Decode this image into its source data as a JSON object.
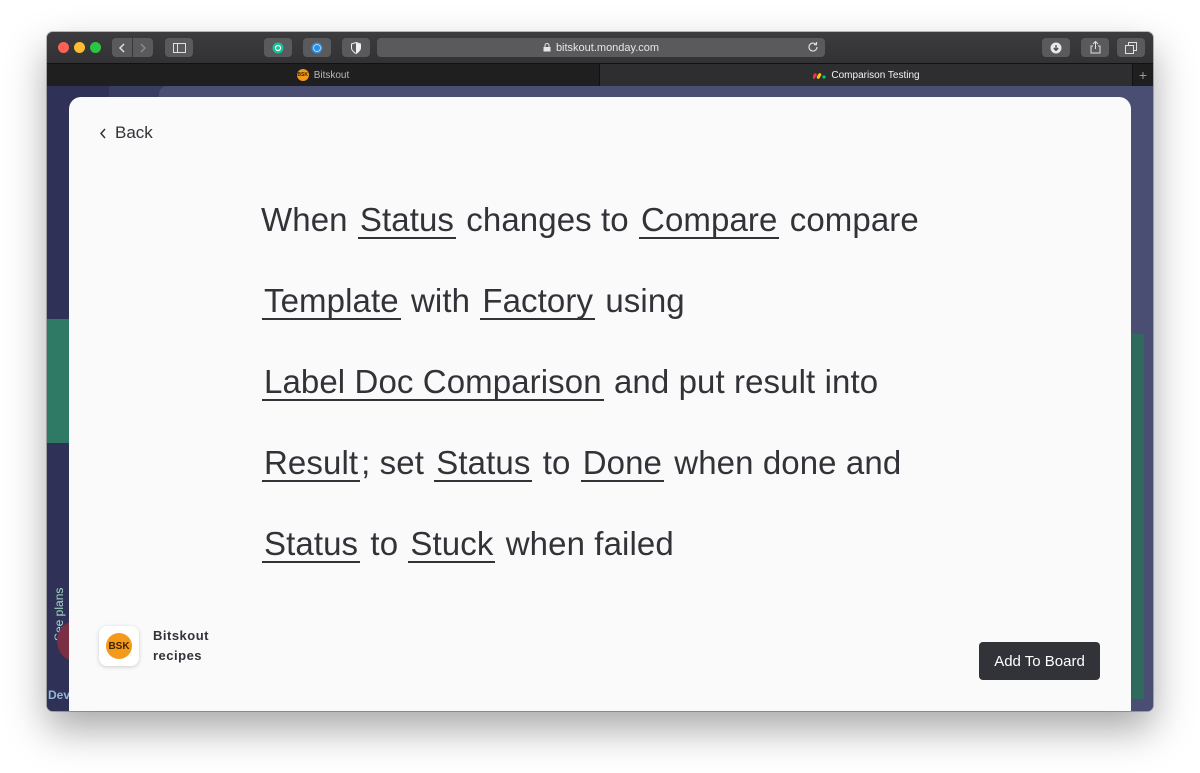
{
  "browser": {
    "url": "bitskout.monday.com",
    "tabs": [
      {
        "label": "Bitskout",
        "icon_text": "BSK",
        "active": false
      },
      {
        "label": "Comparison Testing",
        "active": true
      }
    ]
  },
  "background": {
    "see_plans_label": "See plans",
    "dev_label": "Dev"
  },
  "modal": {
    "back_label": "Back",
    "sentence": {
      "lines": [
        [
          {
            "text": "When ",
            "slot": false
          },
          {
            "text": "Status",
            "slot": true
          },
          {
            "text": " changes to ",
            "slot": false
          },
          {
            "text": "Compare",
            "slot": true
          },
          {
            "text": " compare",
            "slot": false
          }
        ],
        [
          {
            "text": "Template",
            "slot": true
          },
          {
            "text": " with ",
            "slot": false
          },
          {
            "text": "Factory",
            "slot": true
          },
          {
            "text": " using",
            "slot": false
          }
        ],
        [
          {
            "text": "Label Doc Comparison",
            "slot": true
          },
          {
            "text": " and put result into",
            "slot": false
          }
        ],
        [
          {
            "text": "Result",
            "slot": true
          },
          {
            "text": "; set ",
            "slot": false
          },
          {
            "text": "Status",
            "slot": true
          },
          {
            "text": " to ",
            "slot": false
          },
          {
            "text": "Done",
            "slot": true
          },
          {
            "text": " when done and",
            "slot": false
          }
        ],
        [
          {
            "text": "Status",
            "slot": true
          },
          {
            "text": " to ",
            "slot": false
          },
          {
            "text": "Stuck",
            "slot": true
          },
          {
            "text": " when failed",
            "slot": false
          }
        ]
      ]
    },
    "brand": {
      "logo_text": "BSK",
      "name_line1": "Bitskout",
      "name_line2": "recipes"
    },
    "add_button_label": "Add To Board"
  },
  "colors": {
    "bitskout_orange": "#f39a1b",
    "button_dark": "#323338",
    "modal_bg": "#fafafa"
  }
}
